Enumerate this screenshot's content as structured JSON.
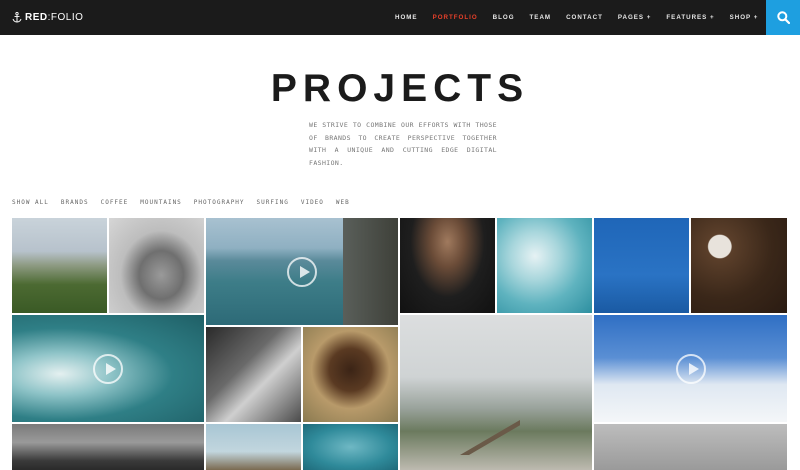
{
  "header": {
    "logo_bold": "RED",
    "logo_rest": ":FOLIO",
    "nav": [
      {
        "label": "HOME",
        "active": false
      },
      {
        "label": "PORTFOLIO",
        "active": true
      },
      {
        "label": "BLOG",
        "active": false
      },
      {
        "label": "TEAM",
        "active": false
      },
      {
        "label": "CONTACT",
        "active": false
      },
      {
        "label": "PAGES +",
        "active": false
      },
      {
        "label": "FEATURES +",
        "active": false
      },
      {
        "label": "SHOP +",
        "active": false
      }
    ],
    "search_icon": "search-icon"
  },
  "page": {
    "title": "PROJECTS",
    "intro": "WE STRIVE TO COMBINE OUR EFFORTS WITH THOSE OF BRANDS TO CREATE PERSPECTIVE TOGETHER WITH A UNIQUE AND CUTTING EDGE DIGITAL FASHION."
  },
  "filters": [
    "SHOW ALL",
    "BRANDS",
    "COFFEE",
    "MOUNTAINS",
    "PHOTOGRAPHY",
    "SURFING",
    "VIDEO",
    "WEB"
  ],
  "colors": {
    "topbar": "#1b1b1b",
    "accent": "#e8402a",
    "search_bg": "#1e9fe0"
  }
}
